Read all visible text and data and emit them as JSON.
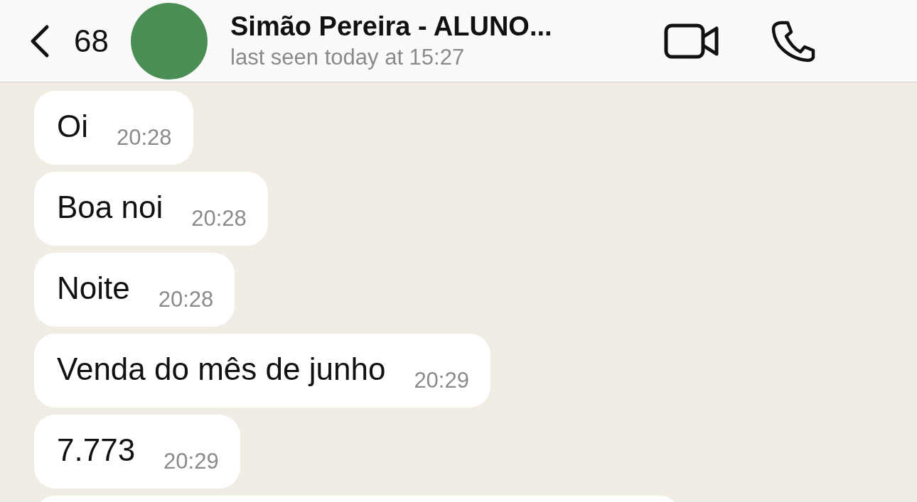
{
  "header": {
    "back_count": "68",
    "contact_name": "Simão Pereira - ALUNO...",
    "status": "last seen today at 15:27"
  },
  "messages": [
    {
      "text": "Oi",
      "time": "20:28"
    },
    {
      "text": "Boa noi",
      "time": "20:28"
    },
    {
      "text": "Noite",
      "time": "20:28"
    },
    {
      "text": "Venda do mês de junho",
      "time": "20:29"
    },
    {
      "text": "7.773",
      "time": "20:29"
    }
  ]
}
